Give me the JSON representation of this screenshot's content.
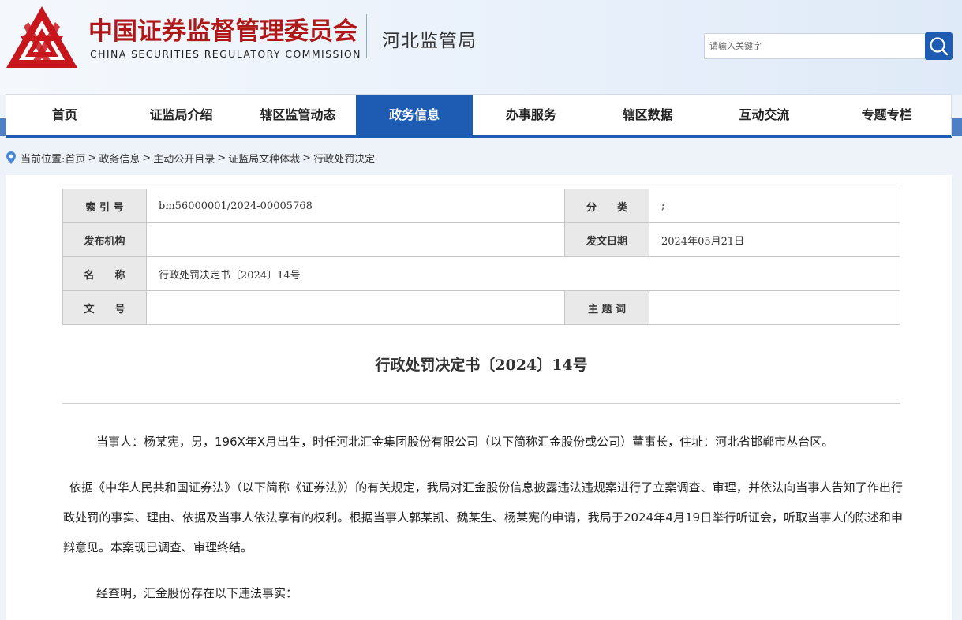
{
  "header": {
    "org_cn": "中国证券监督管理委员会",
    "org_en": "CHINA SECURITIES REGULATORY COMMISSION",
    "bureau": "河北监管局",
    "search_placeholder": "请输入关键字",
    "logo_icon": "csrc-logo-icon",
    "search_icon": "search-icon",
    "brand_color": "#b01818",
    "accent_color": "#1e5cb3"
  },
  "nav": {
    "items": [
      {
        "label": "首页",
        "active": false
      },
      {
        "label": "证监局介绍",
        "active": false
      },
      {
        "label": "辖区监管动态",
        "active": false
      },
      {
        "label": "政务信息",
        "active": true
      },
      {
        "label": "办事服务",
        "active": false
      },
      {
        "label": "辖区数据",
        "active": false
      },
      {
        "label": "互动交流",
        "active": false
      },
      {
        "label": "专题专栏",
        "active": false
      }
    ]
  },
  "breadcrumb": {
    "prefix": "当前位置:",
    "items": [
      "首页",
      "政务信息",
      "主动公开目录",
      "证监局文种体裁",
      "行政处罚决定"
    ],
    "sep": ">"
  },
  "meta": {
    "index_label": "索 引 号",
    "index_value": "bm56000001/2024-00005768",
    "category_label": "分　　类",
    "category_value": ";",
    "publisher_label": "发布机构",
    "publisher_value": "",
    "date_label": "发文日期",
    "date_value": "2024年05月21日",
    "name_label": "名　　称",
    "name_value": "行政处罚决定书〔2024〕14号",
    "docno_label": "文　　号",
    "docno_value": "",
    "keywords_label": "主 题 词",
    "keywords_value": ""
  },
  "document": {
    "title": "行政处罚决定书〔2024〕14号",
    "paragraphs": [
      "当事人：杨某宪，男，196X年X月出生，时任河北汇金集团股份有限公司（以下简称汇金股份或公司）董事长，住址：河北省邯郸市丛台区。",
      "依据《中华人民共和国证券法》（以下简称《证券法》）的有关规定，我局对汇金股份信息披露违法违规案进行了立案调查、审理，并依法向当事人告知了作出行政处罚的事实、理由、依据及当事人依法享有的权利。根据当事人郭某凯、魏某生、杨某宪的申请，我局于2024年4月19日举行听证会，听取当事人的陈述和申辩意见。本案现已调查、审理终结。",
      "经查明，汇金股份存在以下违法事实："
    ]
  }
}
